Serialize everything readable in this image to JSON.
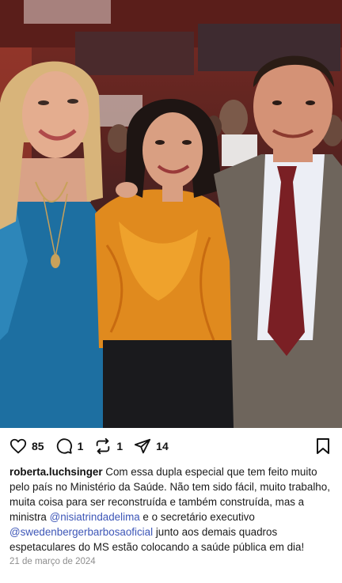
{
  "post": {
    "actions": {
      "likes": "85",
      "comments": "1",
      "reposts": "1",
      "shares": "14"
    },
    "caption": {
      "username": "roberta.luchsinger",
      "text_1": " Com essa dupla especial que tem feito muito pelo país no Ministério da Saúde. Não tem sido fácil, muito trabalho, muita coisa para ser reconstruída e também construída, mas a ministra ",
      "mention_1": "@nisiatrindadelima",
      "text_2": " e o secretário executivo ",
      "mention_2": "@swedenbergerbarbosaoficial",
      "text_3": " junto aos demais quadros espetaculares do MS estão colocando a saúde pública em dia!"
    },
    "date": "21 de março de 2024"
  }
}
